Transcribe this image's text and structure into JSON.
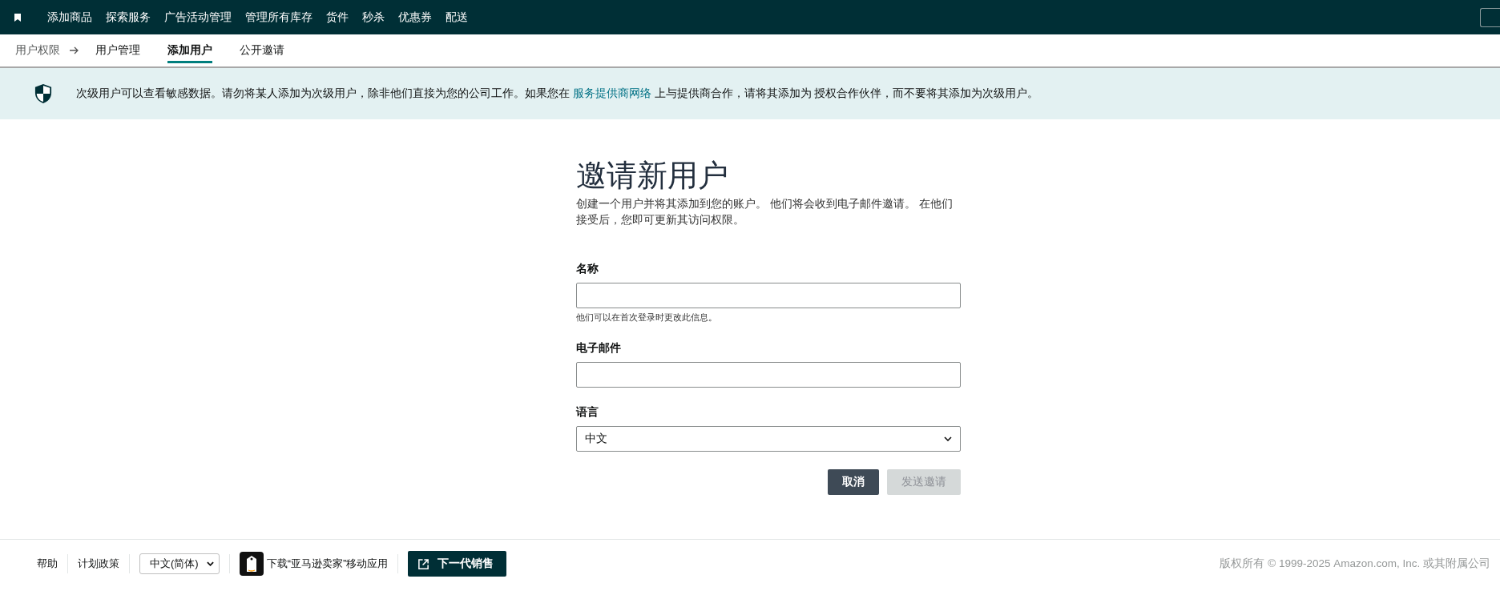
{
  "top_nav": {
    "items": [
      {
        "label": "添加商品"
      },
      {
        "label": "探索服务"
      },
      {
        "label": "广告活动管理"
      },
      {
        "label": "管理所有库存"
      },
      {
        "label": "货件"
      },
      {
        "label": "秒杀"
      },
      {
        "label": "优惠券"
      },
      {
        "label": "配送"
      }
    ]
  },
  "breadcrumb": {
    "root": "用户权限",
    "tabs": [
      {
        "label": "用户管理",
        "selected": false
      },
      {
        "label": "添加用户",
        "selected": true
      },
      {
        "label": "公开邀请",
        "selected": false
      }
    ]
  },
  "banner": {
    "text_before": "次级用户可以查看敏感数据。请勿将某人添加为次级用户，除非他们直接为您的公司工作。如果您在",
    "link": "服务提供商网络",
    "text_after": "上与提供商合作，请将其添加为 授权合作伙伴，而不要将其添加为次级用户。"
  },
  "form": {
    "title": "邀请新用户",
    "description": "创建一个用户并将其添加到您的账户。 他们将会收到电子邮件邀请。 在他们接受后，您即可更新其访问权限。",
    "fields": [
      {
        "kind": "text",
        "label": "名称",
        "hint": "他们可以在首次登录时更改此信息。"
      },
      {
        "kind": "text",
        "label": "电子邮件"
      },
      {
        "kind": "select",
        "label": "语言",
        "value": "中文"
      }
    ],
    "buttons": [
      {
        "label": "取消",
        "disabled": false
      },
      {
        "label": "发送邀请",
        "disabled": true
      }
    ]
  },
  "footer": {
    "links": [
      "帮助",
      "计划政策"
    ],
    "language": "中文(简体)",
    "app_download": "下载“亚马逊卖家”移动应用",
    "next_gen_button": "下一代销售",
    "copyright": "版权所有 © 1999-2025 Amazon.com, Inc. 或其附属公司"
  }
}
